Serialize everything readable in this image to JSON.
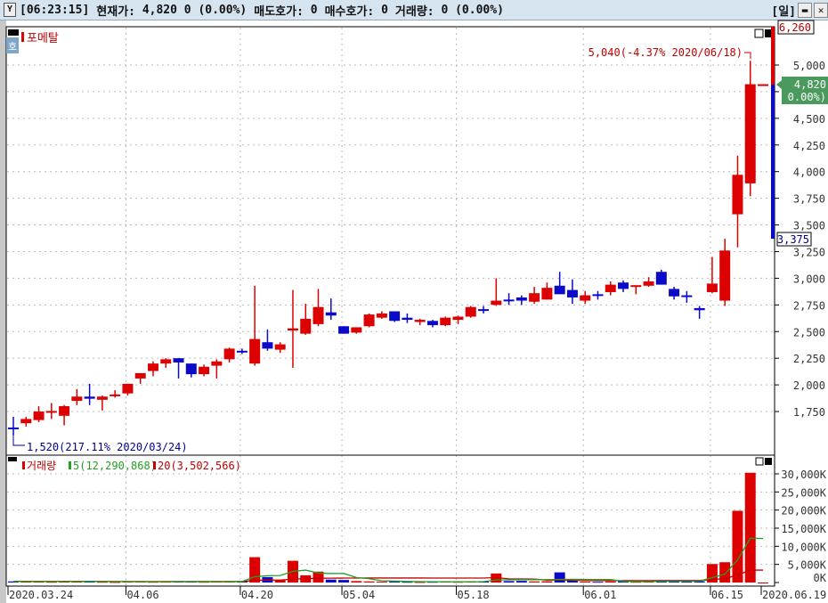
{
  "title_bar": {
    "time": "[06:23:15]",
    "price_label": "현재가:",
    "price": "4,820",
    "change": "0",
    "change_pct": "(0.00%)",
    "ask_label": "매도호가:",
    "ask": "0",
    "bid_label": "매수호가:",
    "bid": "0",
    "vol_label": "거래량:",
    "vol": "0",
    "vol_pct": "(0.00%)",
    "period": "[일]",
    "restore_icon": "window-restore-icon",
    "close_icon": "close-icon"
  },
  "price_panel": {
    "name": "포메탈",
    "side_icon": "호",
    "high_marker": "5,040(-4.37% 2020/06/18)",
    "low_marker": "1,520(217.11% 2020/03/24)",
    "upper_limit": "6,260",
    "lower_limit": "3,375",
    "current": "4,820",
    "current_pct": "( 0.00%)",
    "ticks": [
      "5,000",
      "4,750",
      "4,500",
      "4,250",
      "4,000",
      "3,750",
      "3,500",
      "3,250",
      "3,000",
      "2,750",
      "2,500",
      "2,250",
      "2,000",
      "1,750"
    ]
  },
  "volume_panel": {
    "name": "거래량",
    "ma5": "5(12,290,868)",
    "ma20": "20(3,502,566)",
    "ticks": [
      "30,000K",
      "25,000K",
      "20,000K",
      "15,000K",
      "10,000K",
      "5,000K",
      "0K"
    ]
  },
  "x_labels": [
    "2020.03.24",
    "04.06",
    "04.20",
    "05.04",
    "05.18",
    "06.01",
    "06.15",
    "2020.06.19"
  ],
  "colors": {
    "up": "#dd0000",
    "down": "#0a0ac8",
    "ma5": "#22a022",
    "ma20": "#c00000",
    "current_tag": "#4a9a5e"
  },
  "chart_data": {
    "type": "candlestick",
    "price_range": [
      1520,
      6260
    ],
    "volume_range_k": [
      0,
      30000
    ],
    "ohlc": [
      [
        1600,
        1700,
        1520,
        1590
      ],
      [
        1640,
        1700,
        1610,
        1680
      ],
      [
        1670,
        1800,
        1650,
        1750
      ],
      [
        1750,
        1830,
        1680,
        1755
      ],
      [
        1710,
        1810,
        1620,
        1800
      ],
      [
        1850,
        1960,
        1810,
        1890
      ],
      [
        1890,
        2010,
        1810,
        1870
      ],
      [
        1860,
        1900,
        1760,
        1890
      ],
      [
        1900,
        1950,
        1880,
        1910
      ],
      [
        1920,
        2010,
        1900,
        2010
      ],
      [
        2060,
        2110,
        2010,
        2110
      ],
      [
        2130,
        2220,
        2080,
        2200
      ],
      [
        2200,
        2250,
        2160,
        2240
      ],
      [
        2250,
        2250,
        2060,
        2210
      ],
      [
        2200,
        2200,
        2070,
        2100
      ],
      [
        2100,
        2190,
        2080,
        2170
      ],
      [
        2180,
        2240,
        2060,
        2220
      ],
      [
        2240,
        2350,
        2210,
        2340
      ],
      [
        2320,
        2340,
        2290,
        2310
      ],
      [
        2200,
        2930,
        2180,
        2430
      ],
      [
        2400,
        2520,
        2320,
        2340
      ],
      [
        2330,
        2400,
        2300,
        2380
      ],
      [
        2510,
        2890,
        2160,
        2530
      ],
      [
        2480,
        2760,
        2470,
        2620
      ],
      [
        2570,
        2900,
        2550,
        2730
      ],
      [
        2680,
        2810,
        2610,
        2650
      ],
      [
        2550,
        2550,
        2480,
        2480
      ],
      [
        2490,
        2540,
        2480,
        2540
      ],
      [
        2550,
        2670,
        2540,
        2660
      ],
      [
        2630,
        2690,
        2620,
        2670
      ],
      [
        2690,
        2690,
        2590,
        2600
      ],
      [
        2630,
        2670,
        2580,
        2610
      ],
      [
        2590,
        2620,
        2560,
        2610
      ],
      [
        2600,
        2610,
        2540,
        2560
      ],
      [
        2560,
        2640,
        2550,
        2630
      ],
      [
        2610,
        2650,
        2570,
        2640
      ],
      [
        2640,
        2740,
        2630,
        2730
      ],
      [
        2710,
        2740,
        2670,
        2700
      ],
      [
        2750,
        3000,
        2740,
        2790
      ],
      [
        2800,
        2860,
        2750,
        2790
      ],
      [
        2820,
        2840,
        2750,
        2790
      ],
      [
        2780,
        2920,
        2760,
        2860
      ],
      [
        2800,
        2960,
        2800,
        2910
      ],
      [
        2930,
        3060,
        2860,
        2850
      ],
      [
        2890,
        2990,
        2760,
        2820
      ],
      [
        2790,
        2880,
        2760,
        2840
      ],
      [
        2850,
        2880,
        2800,
        2840
      ],
      [
        2870,
        2970,
        2840,
        2940
      ],
      [
        2960,
        2980,
        2870,
        2900
      ],
      [
        2920,
        2930,
        2850,
        2935
      ],
      [
        2930,
        3010,
        2920,
        2970
      ],
      [
        3060,
        3080,
        2940,
        2940
      ],
      [
        2900,
        2920,
        2800,
        2830
      ],
      [
        2840,
        2880,
        2770,
        2830
      ],
      [
        2720,
        2740,
        2620,
        2700
      ],
      [
        2870,
        3200,
        2860,
        2950
      ],
      [
        2790,
        3370,
        2740,
        3260
      ],
      [
        3600,
        4150,
        3290,
        3970
      ],
      [
        3890,
        5040,
        3770,
        4820
      ],
      [
        4820,
        4820,
        4820,
        4820
      ]
    ],
    "volume_k": [
      300,
      350,
      300,
      200,
      400,
      300,
      250,
      200,
      150,
      300,
      250,
      200,
      220,
      300,
      250,
      200,
      300,
      250,
      300,
      7000,
      1500,
      600,
      6000,
      2000,
      3000,
      800,
      700,
      400,
      300,
      250,
      300,
      200,
      150,
      200,
      250,
      200,
      300,
      250,
      2500,
      400,
      450,
      300,
      350,
      2800,
      500,
      250,
      200,
      300,
      350,
      200,
      300,
      600,
      400,
      300,
      350,
      5100,
      5600,
      19800,
      30300,
      0
    ]
  }
}
